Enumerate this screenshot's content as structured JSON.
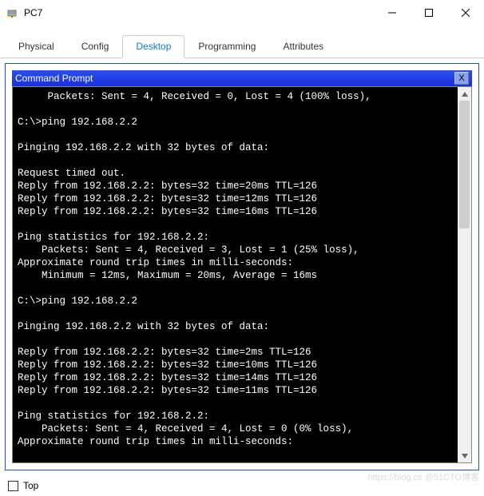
{
  "window": {
    "title": "PC7"
  },
  "tabs": [
    {
      "label": "Physical"
    },
    {
      "label": "Config"
    },
    {
      "label": "Desktop"
    },
    {
      "label": "Programming"
    },
    {
      "label": "Attributes"
    }
  ],
  "active_tab": 2,
  "cmd": {
    "title": "Command Prompt",
    "close": "X"
  },
  "terminal_lines": [
    "     Packets: Sent = 4, Received = 0, Lost = 4 (100% loss),",
    "",
    "C:\\>ping 192.168.2.2",
    "",
    "Pinging 192.168.2.2 with 32 bytes of data:",
    "",
    "Request timed out.",
    "Reply from 192.168.2.2: bytes=32 time=20ms TTL=126",
    "Reply from 192.168.2.2: bytes=32 time=12ms TTL=126",
    "Reply from 192.168.2.2: bytes=32 time=16ms TTL=126",
    "",
    "Ping statistics for 192.168.2.2:",
    "    Packets: Sent = 4, Received = 3, Lost = 1 (25% loss),",
    "Approximate round trip times in milli-seconds:",
    "    Minimum = 12ms, Maximum = 20ms, Average = 16ms",
    "",
    "C:\\>ping 192.168.2.2",
    "",
    "Pinging 192.168.2.2 with 32 bytes of data:",
    "",
    "Reply from 192.168.2.2: bytes=32 time=2ms TTL=126",
    "Reply from 192.168.2.2: bytes=32 time=10ms TTL=126",
    "Reply from 192.168.2.2: bytes=32 time=14ms TTL=126",
    "Reply from 192.168.2.2: bytes=32 time=11ms TTL=126",
    "",
    "Ping statistics for 192.168.2.2:",
    "    Packets: Sent = 4, Received = 4, Lost = 0 (0% loss),",
    "Approximate round trip times in milli-seconds:"
  ],
  "bottom": {
    "top_label": "Top"
  },
  "watermark": "https://blog.cs   @51CTO博客"
}
